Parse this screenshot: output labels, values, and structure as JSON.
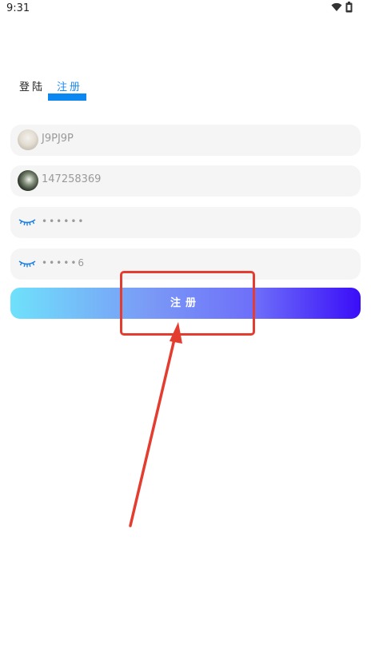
{
  "status_bar": {
    "time": "9:31",
    "icons": [
      "wifi-icon",
      "battery-icon"
    ]
  },
  "tabs": [
    {
      "label": "登陆",
      "active": false
    },
    {
      "label": "注册",
      "active": true
    }
  ],
  "form": {
    "username_value": "J9PJ9P",
    "phone_value": "147258369",
    "password_value": "••••••",
    "confirm_password_value": "•••••6",
    "submit_label": "注册"
  },
  "colors": {
    "accent": "#0a87f0",
    "annotation": "#e43d2f"
  }
}
